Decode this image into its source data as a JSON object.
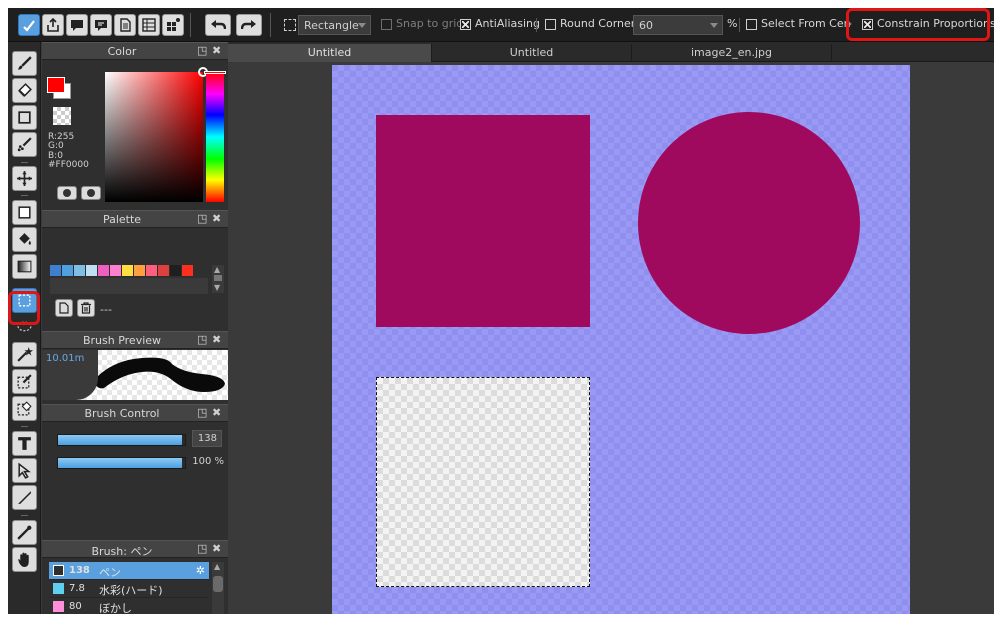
{
  "toolbar": {
    "shape_select": "Rectangle",
    "snap_to_grid": "Snap to grid",
    "antialiasing": "AntiAliasing",
    "round_corners": "Round Corners",
    "round_value": "60",
    "percent": "%",
    "select_from_center": "Select From Cen",
    "constrain_proportions": "Constrain Proportions"
  },
  "color_panel": {
    "title": "Color",
    "r": "R:255",
    "g": "G:0",
    "b": "B:0",
    "hex": "#FF0000"
  },
  "palette_panel": {
    "title": "Palette",
    "name_value": "---",
    "colors": [
      "#3f7fcf",
      "#4fa0df",
      "#7fbfe6",
      "#bfdff3",
      "#ef5fbf",
      "#ff7fcf",
      "#ffdf3f",
      "#ff9f3f",
      "#ff5f7f",
      "#df3f3f",
      "#1f1f1f",
      "#ff2f1f"
    ]
  },
  "brush_preview_panel": {
    "title": "Brush Preview",
    "size_label": "10.01m"
  },
  "brush_control_panel": {
    "title": "Brush Control",
    "size_value": "138",
    "opacity_value": "100 %",
    "size_fill": 0.98,
    "opacity_fill": 0.98
  },
  "brush_panel": {
    "title": "Brush: ペン",
    "items": [
      {
        "size": "138",
        "name": "ペン",
        "color": "#2f2f2f"
      },
      {
        "size": "7.8",
        "name": "水彩(ハード)",
        "color": "#5fd0f0"
      },
      {
        "size": "80",
        "name": "ぼかし",
        "color": "#ff8fd8"
      }
    ]
  },
  "tabs": [
    "Untitled",
    "Untitled",
    "image2_en.jpg"
  ]
}
